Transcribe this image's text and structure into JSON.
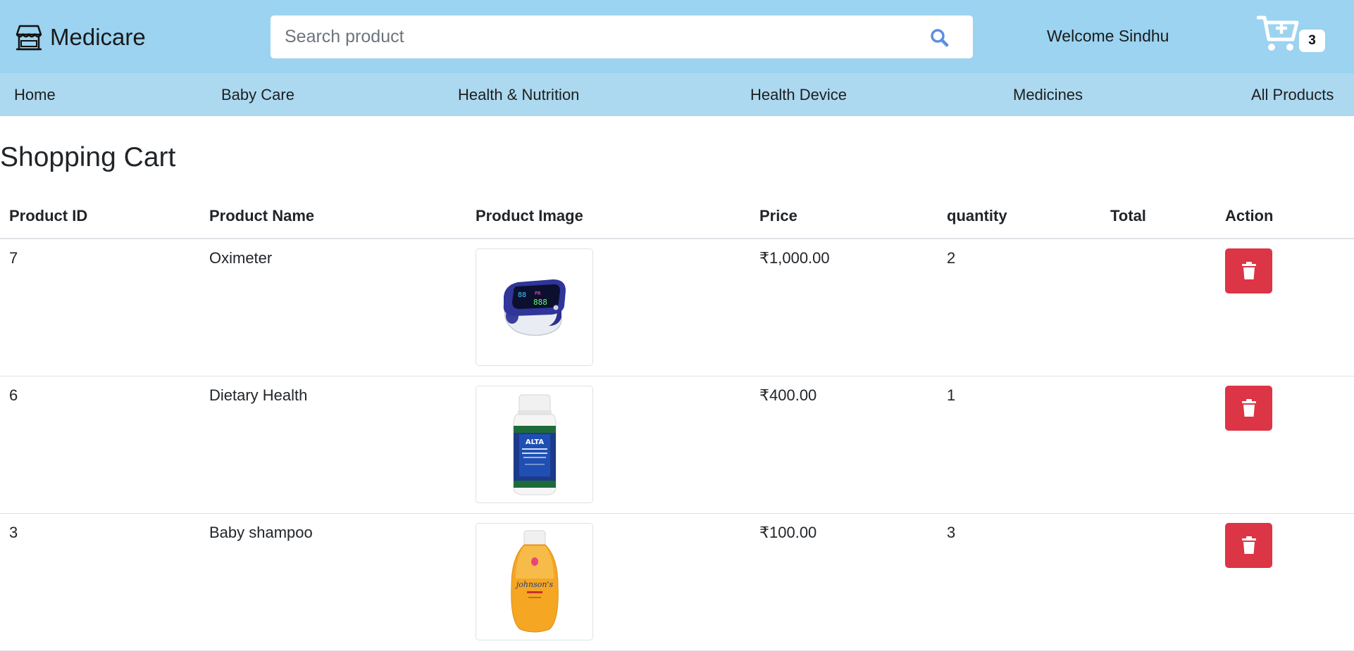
{
  "brand": {
    "name": "Medicare",
    "icon": "store-icon"
  },
  "search": {
    "placeholder": "Search product",
    "value": "",
    "icon": "search-icon"
  },
  "user": {
    "welcome": "Welcome Sindhu"
  },
  "cart": {
    "icon": "cart-plus-icon",
    "count": "3"
  },
  "nav": {
    "items": [
      {
        "label": "Home"
      },
      {
        "label": "Baby Care"
      },
      {
        "label": "Health & Nutrition"
      },
      {
        "label": "Health Device"
      },
      {
        "label": "Medicines"
      },
      {
        "label": "All Products"
      }
    ]
  },
  "page": {
    "title": "Shopping Cart"
  },
  "table": {
    "headers": [
      "Product ID",
      "Product Name",
      "Product Image",
      "Price",
      "quantity",
      "Total",
      "Action"
    ],
    "rows": [
      {
        "id": "7",
        "name": "Oximeter",
        "image": "oximeter-image",
        "price": "₹1,000.00",
        "quantity": "2",
        "total": "",
        "action_icon": "trash-icon"
      },
      {
        "id": "6",
        "name": "Dietary Health",
        "image": "supplement-bottle-image",
        "price": "₹400.00",
        "quantity": "1",
        "total": "",
        "action_icon": "trash-icon"
      },
      {
        "id": "3",
        "name": "Baby shampoo",
        "image": "shampoo-bottle-image",
        "price": "₹100.00",
        "quantity": "3",
        "total": "",
        "action_icon": "trash-icon"
      }
    ]
  },
  "colors": {
    "header_bg": "#9bd3f0",
    "nav_bg": "#acd9f0",
    "delete_button": "#dc3545",
    "search_icon": "#5b8fe0"
  }
}
